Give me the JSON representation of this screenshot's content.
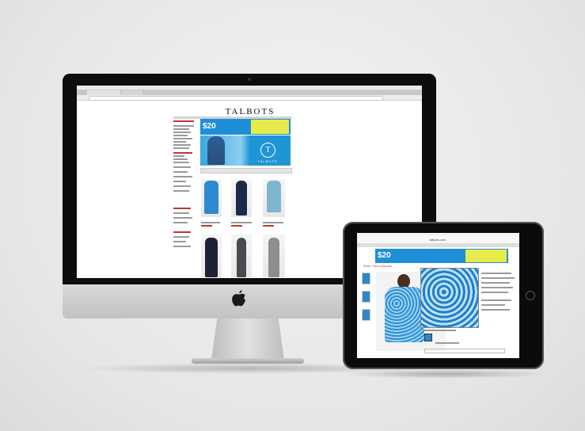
{
  "scene": {
    "description_devices": [
      "imac",
      "ipad"
    ]
  },
  "imac_screen": {
    "logo_text": "TALBOTS",
    "promo_big": "$20",
    "hero_brand": "TALBOTS",
    "hero_monogram": "T"
  },
  "ipad_screen": {
    "url_text": "talbots.com",
    "promo_big": "$20",
    "breadcrumb": "Shirts / Tops & Blouses"
  },
  "icons": {
    "apple_logo": "apple-logo-icon"
  },
  "colors": {
    "promo_blue": "#1e8fd6",
    "promo_yellow": "#e7ec4c",
    "accent_red": "#c0392b"
  }
}
